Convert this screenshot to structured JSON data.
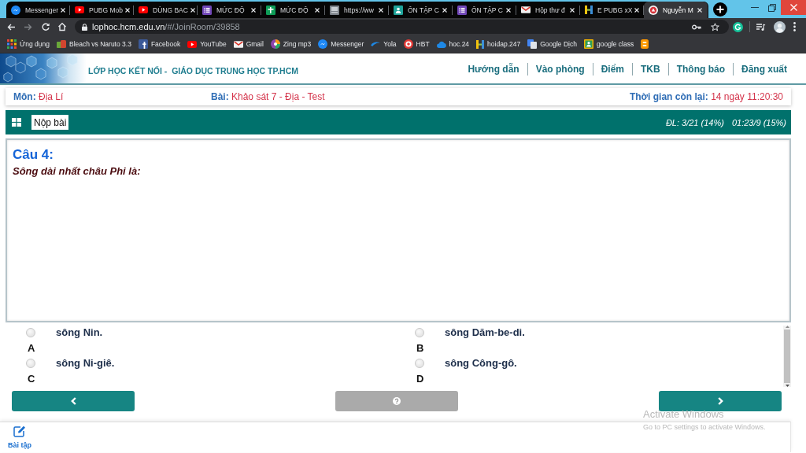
{
  "browser": {
    "tabs": [
      {
        "title": "Messenger",
        "kind": "chat",
        "selected": false
      },
      {
        "title": "PUBG Mob",
        "kind": "video",
        "selected": false
      },
      {
        "title": "DÙNG BAC",
        "kind": "video",
        "selected": false
      },
      {
        "title": "MỨC ĐỘ",
        "kind": "form",
        "selected": false
      },
      {
        "title": "MỨC ĐỘ",
        "kind": "sheet",
        "selected": false
      },
      {
        "title": "https://ww",
        "kind": "page",
        "selected": false
      },
      {
        "title": "ÔN TẬP C",
        "kind": "classroom",
        "selected": false
      },
      {
        "title": "ÔN TẬP C",
        "kind": "form",
        "selected": false
      },
      {
        "title": "Hộp thư đ",
        "kind": "mail",
        "selected": false
      },
      {
        "title": "E PUBG xX",
        "kind": "pillars",
        "selected": false
      },
      {
        "title": "Nguyễn M",
        "kind": "school",
        "selected": true
      }
    ],
    "address": {
      "host": "lophoc.hcm.edu.vn",
      "path": "/#/JoinRoom/39858"
    },
    "bookmarks": [
      {
        "label": "Ứng dụng",
        "kind": "apps"
      },
      {
        "label": "Bleach vs Naruto 3.3",
        "kind": "game"
      },
      {
        "label": "Facebook",
        "kind": "social"
      },
      {
        "label": "YouTube",
        "kind": "video"
      },
      {
        "label": "Gmail",
        "kind": "mail"
      },
      {
        "label": "Zing mp3",
        "kind": "music"
      },
      {
        "label": "Messenger",
        "kind": "chat"
      },
      {
        "label": "Yola",
        "kind": "swoosh"
      },
      {
        "label": "HBT",
        "kind": "ring"
      },
      {
        "label": "hoc.24",
        "kind": "cloud"
      },
      {
        "label": "hoidap.247",
        "kind": "pillars"
      },
      {
        "label": "Google Dịch",
        "kind": "translate"
      },
      {
        "label": "google class",
        "kind": "board"
      },
      {
        "kind": "blog"
      }
    ]
  },
  "site": {
    "title": "LỚP HỌC KẾT NỐI -  GIÁO DỤC TRUNG HỌC TP.HCM",
    "nav": [
      "Hướng dẫn",
      "Vào phòng",
      "Điểm",
      "TKB",
      "Thông báo",
      "Đăng xuất"
    ]
  },
  "exam_info": [
    {
      "label": "Môn:",
      "value": "Địa Lí"
    },
    {
      "label": "Bài:",
      "value": "Khảo sát 7 - Địa - Test"
    },
    {
      "label": "Thời gian còn lại:",
      "value": "14 ngày 11:20:30"
    }
  ],
  "toolbar": {
    "submit": "Nộp bài",
    "progress": "ĐL: 3/21 (14%)",
    "elapsed": "01:23/9 (15%)"
  },
  "question": {
    "number": "Câu 4:",
    "text": "Sông dài nhất châu Phi là:",
    "options": [
      {
        "letter": "A",
        "text": "sông Nin.",
        "selected": false
      },
      {
        "letter": "B",
        "text": "sông Dăm-be-di.",
        "selected": false
      },
      {
        "letter": "C",
        "text": "sông Ni-giê.",
        "selected": false
      },
      {
        "letter": "D",
        "text": "sông Công-gô.",
        "selected": false
      }
    ]
  },
  "footer": {
    "items": [
      {
        "label": "Bài tập"
      }
    ]
  },
  "system_notice": {
    "title": "Activate Windows",
    "detail": "Go to PC settings to activate Windows."
  }
}
